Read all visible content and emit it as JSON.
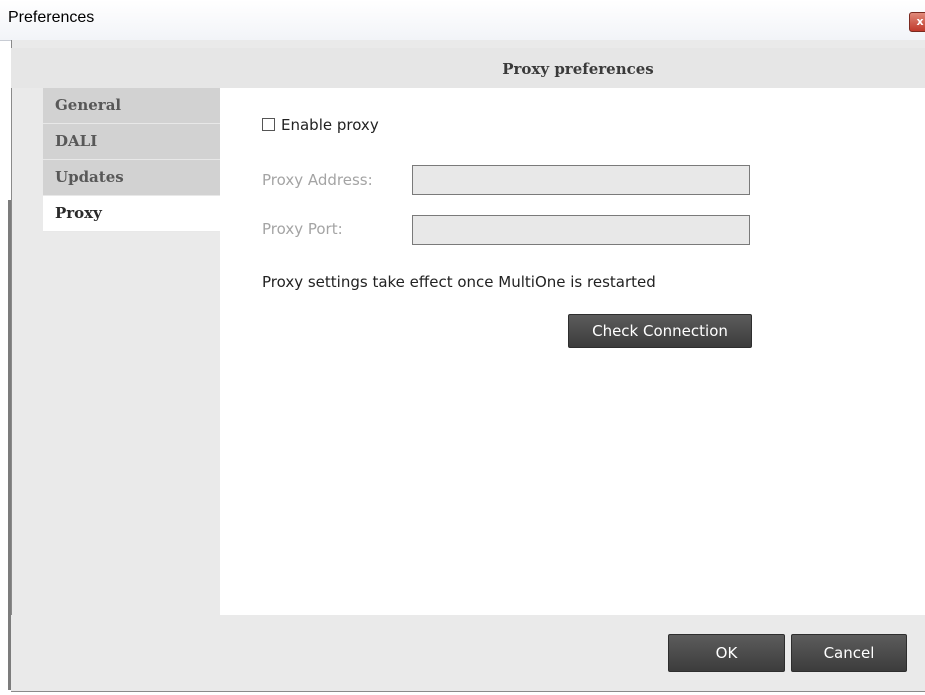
{
  "window": {
    "title": "Preferences",
    "close_glyph": "x"
  },
  "header": {
    "title": "Proxy preferences"
  },
  "sidebar": {
    "items": [
      {
        "label": "General"
      },
      {
        "label": "DALI"
      },
      {
        "label": "Updates"
      },
      {
        "label": "Proxy"
      }
    ],
    "active": "Proxy"
  },
  "proxy": {
    "enable_label": "Enable proxy",
    "enable_checked": false,
    "address_label": "Proxy Address:",
    "address_value": "",
    "port_label": "Proxy Port:",
    "port_value": "",
    "note": "Proxy settings take effect once MultiOne is restarted",
    "check_button": "Check Connection"
  },
  "footer": {
    "ok_label": "OK",
    "cancel_label": "Cancel"
  },
  "colors": {
    "frame_bg": "#eaeaea",
    "sidebar_bg": "#d2d2d2",
    "button_dark": "#4a4a4a",
    "close_red": "#c0392b"
  }
}
